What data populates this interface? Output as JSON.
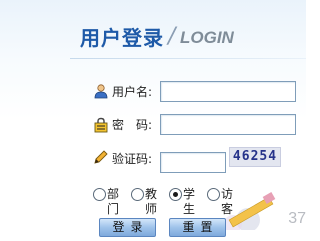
{
  "header": {
    "title": "用户登录",
    "separator": "/",
    "subtitle": "LOGIN"
  },
  "form": {
    "username_label": "用户名:",
    "username_value": "",
    "password_label": "密　码:",
    "password_value": "",
    "captcha_label": "验证码:",
    "captcha_value": "",
    "captcha_code": "46254"
  },
  "roles": {
    "selected": "学生",
    "options": [
      "部门",
      "教师",
      "学生",
      "访客"
    ]
  },
  "buttons": {
    "login": "登录",
    "reset": "重置"
  },
  "decor": {
    "corner_text": "37"
  },
  "icons": {
    "user": "user-icon",
    "lock": "lock-icon",
    "pencil": "pencil-icon"
  },
  "colors": {
    "title": "#1e5aa8",
    "field_border": "#7f9db9",
    "button": "#9fc3ea"
  }
}
